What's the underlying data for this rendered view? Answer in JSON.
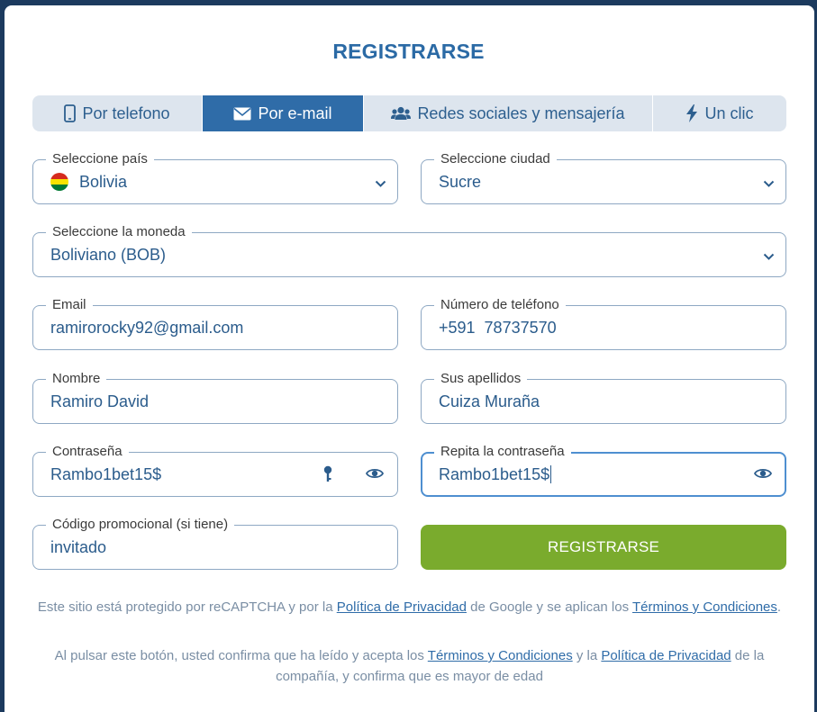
{
  "title": "REGISTRARSE",
  "tabs": [
    {
      "label": "Por telefono",
      "icon": "phone-icon",
      "active": false
    },
    {
      "label": "Por e-mail",
      "icon": "envelope-icon",
      "active": true
    },
    {
      "label": "Redes sociales y mensajería",
      "icon": "users-icon",
      "active": false
    },
    {
      "label": "Un clic",
      "icon": "lightning-icon",
      "active": false
    }
  ],
  "form": {
    "country": {
      "label": "Seleccione país",
      "value": "Bolivia"
    },
    "city": {
      "label": "Seleccione ciudad",
      "value": "Sucre"
    },
    "currency": {
      "label": "Seleccione la moneda",
      "value": "Boliviano (BOB)"
    },
    "email": {
      "label": "Email",
      "value": "ramirorocky92@gmail.com"
    },
    "phone": {
      "label": "Número de teléfono",
      "value": "+591  78737570"
    },
    "first_name": {
      "label": "Nombre",
      "value": "Ramiro David"
    },
    "last_name": {
      "label": "Sus apellidos",
      "value": "Cuiza Muraña"
    },
    "password": {
      "label": "Contraseña",
      "value": "Rambo1bet15$"
    },
    "password_repeat": {
      "label": "Repita la contraseña",
      "value": "Rambo1bet15$"
    },
    "promo": {
      "label": "Código promocional (si tiene)",
      "value": "invitado"
    }
  },
  "submit_label": "REGISTRARSE",
  "recaptcha_note": {
    "pre": "Este sitio está protegido por reCAPTCHA y por la ",
    "privacy_link": "Política de Privacidad",
    "mid": " de Google y se aplican los ",
    "terms_link": "Términos y Condiciones",
    "post": "."
  },
  "consent_note": {
    "pre": "Al pulsar este botón, usted confirma que ha leído y acepta los ",
    "terms_link": "Términos y Condiciones",
    "mid": " y la ",
    "privacy_link": "Política de Privacidad",
    "post": " de la compañía, y confirma que es mayor de edad"
  },
  "colors": {
    "primary": "#2f6ca8",
    "submit": "#7aab2d",
    "tab_bg": "#dde5ee",
    "flag_red": "#d52b1e",
    "flag_yellow": "#f9e300",
    "flag_green": "#007934"
  }
}
